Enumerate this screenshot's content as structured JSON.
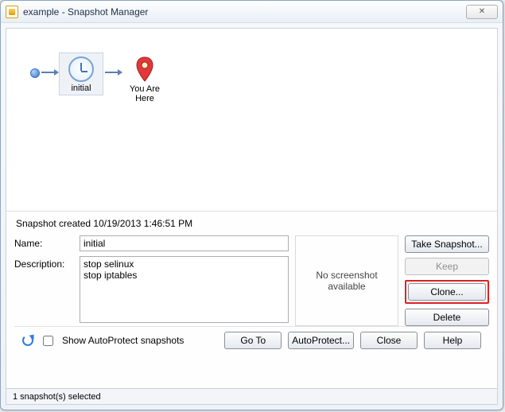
{
  "window": {
    "title": "example - Snapshot Manager"
  },
  "tree": {
    "snapshot": {
      "label": "initial"
    },
    "current": {
      "label_l1": "You Are",
      "label_l2": "Here"
    }
  },
  "details": {
    "created": "Snapshot created 10/19/2013 1:46:51 PM",
    "name_label": "Name:",
    "name_value": "initial",
    "desc_label": "Description:",
    "desc_value": "stop selinux\nstop iptables",
    "screenshot_msg": "No screenshot available"
  },
  "buttons": {
    "take_snapshot": "Take Snapshot...",
    "keep": "Keep",
    "clone": "Clone...",
    "delete": "Delete",
    "goto": "Go To",
    "autoprotect": "AutoProtect...",
    "close": "Close",
    "help": "Help"
  },
  "bottom": {
    "show_autoprotect": "Show AutoProtect snapshots"
  },
  "status": {
    "text": "1 snapshot(s) selected"
  }
}
